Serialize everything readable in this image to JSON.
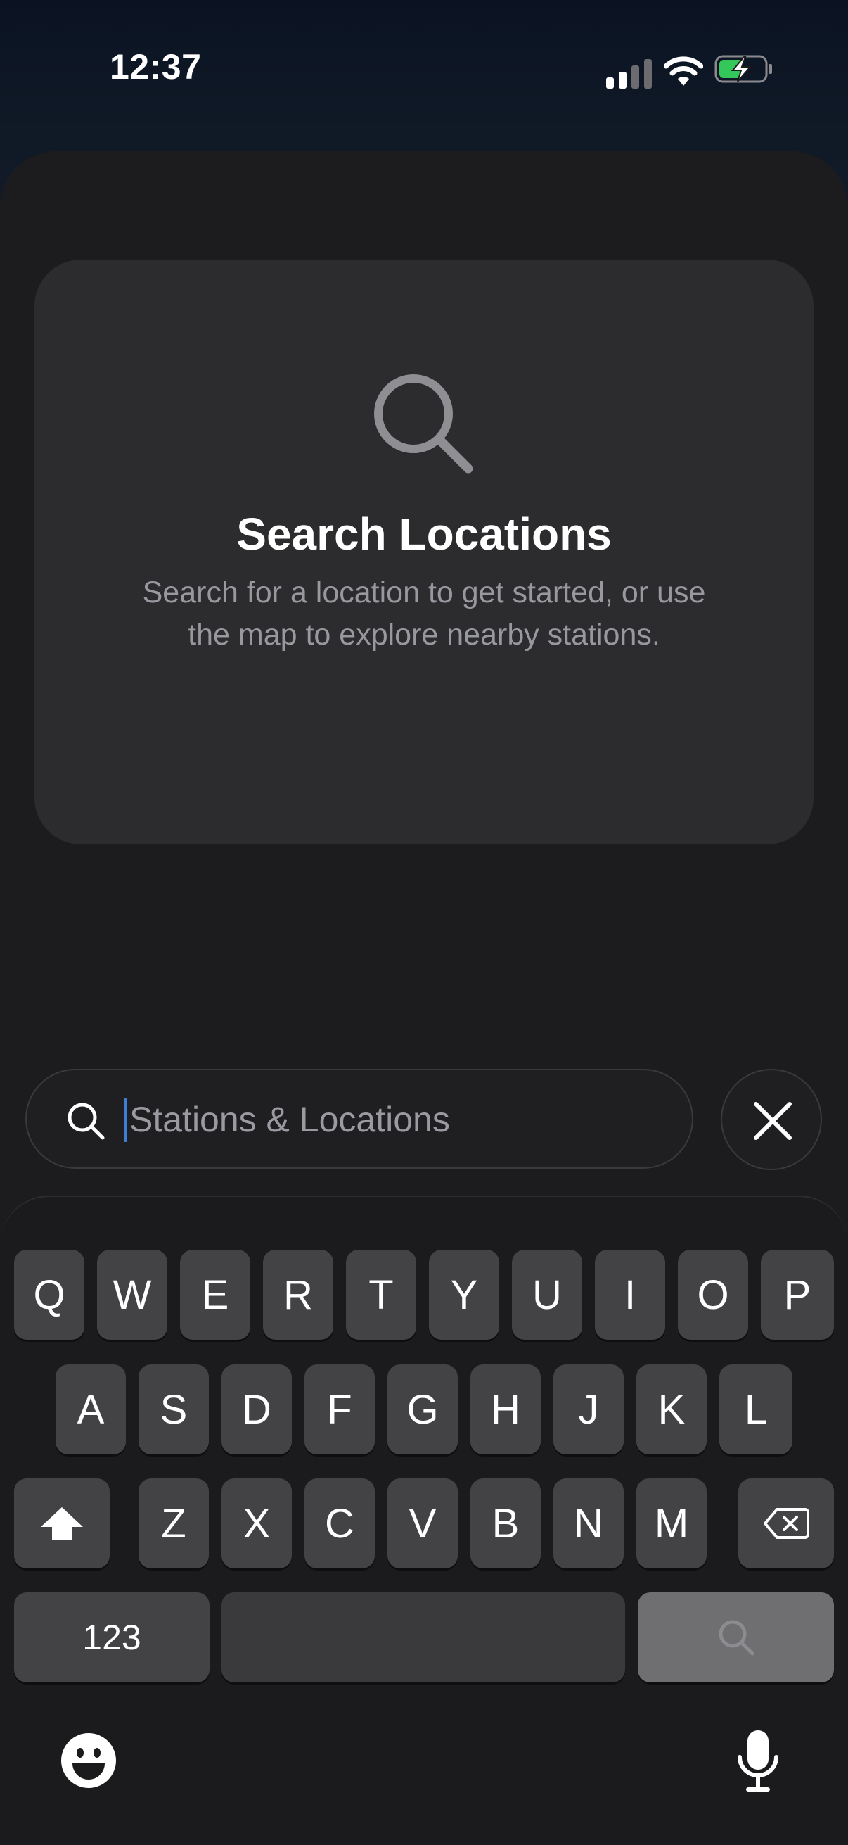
{
  "status_bar": {
    "time": "12:37",
    "signal_icon": "cellular-signal-icon",
    "wifi_icon": "wifi-icon",
    "battery_icon": "battery-charging-icon",
    "battery_color": "#34c759"
  },
  "empty_state": {
    "icon": "search-icon",
    "title": "Search Locations",
    "description": "Search for a location to get started, or use the map to explore nearby stations."
  },
  "search": {
    "placeholder": "Stations & Locations",
    "value": "",
    "icon": "search-icon",
    "close_icon": "close-icon"
  },
  "keyboard": {
    "row1": [
      "Q",
      "W",
      "E",
      "R",
      "T",
      "Y",
      "U",
      "I",
      "O",
      "P"
    ],
    "row2": [
      "A",
      "S",
      "D",
      "F",
      "G",
      "H",
      "J",
      "K",
      "L"
    ],
    "row3": [
      "Z",
      "X",
      "C",
      "V",
      "B",
      "N",
      "M"
    ],
    "shift_icon": "shift-icon",
    "delete_icon": "delete-backward-icon",
    "numbers_label": "123",
    "space_label": "",
    "search_key_icon": "search-icon",
    "emoji_icon": "emoji-icon",
    "dictation_icon": "microphone-icon"
  },
  "colors": {
    "accent_caret": "#3d7fd6",
    "sheet_bg": "#1c1c1e",
    "card_bg": "#2c2c2e"
  }
}
